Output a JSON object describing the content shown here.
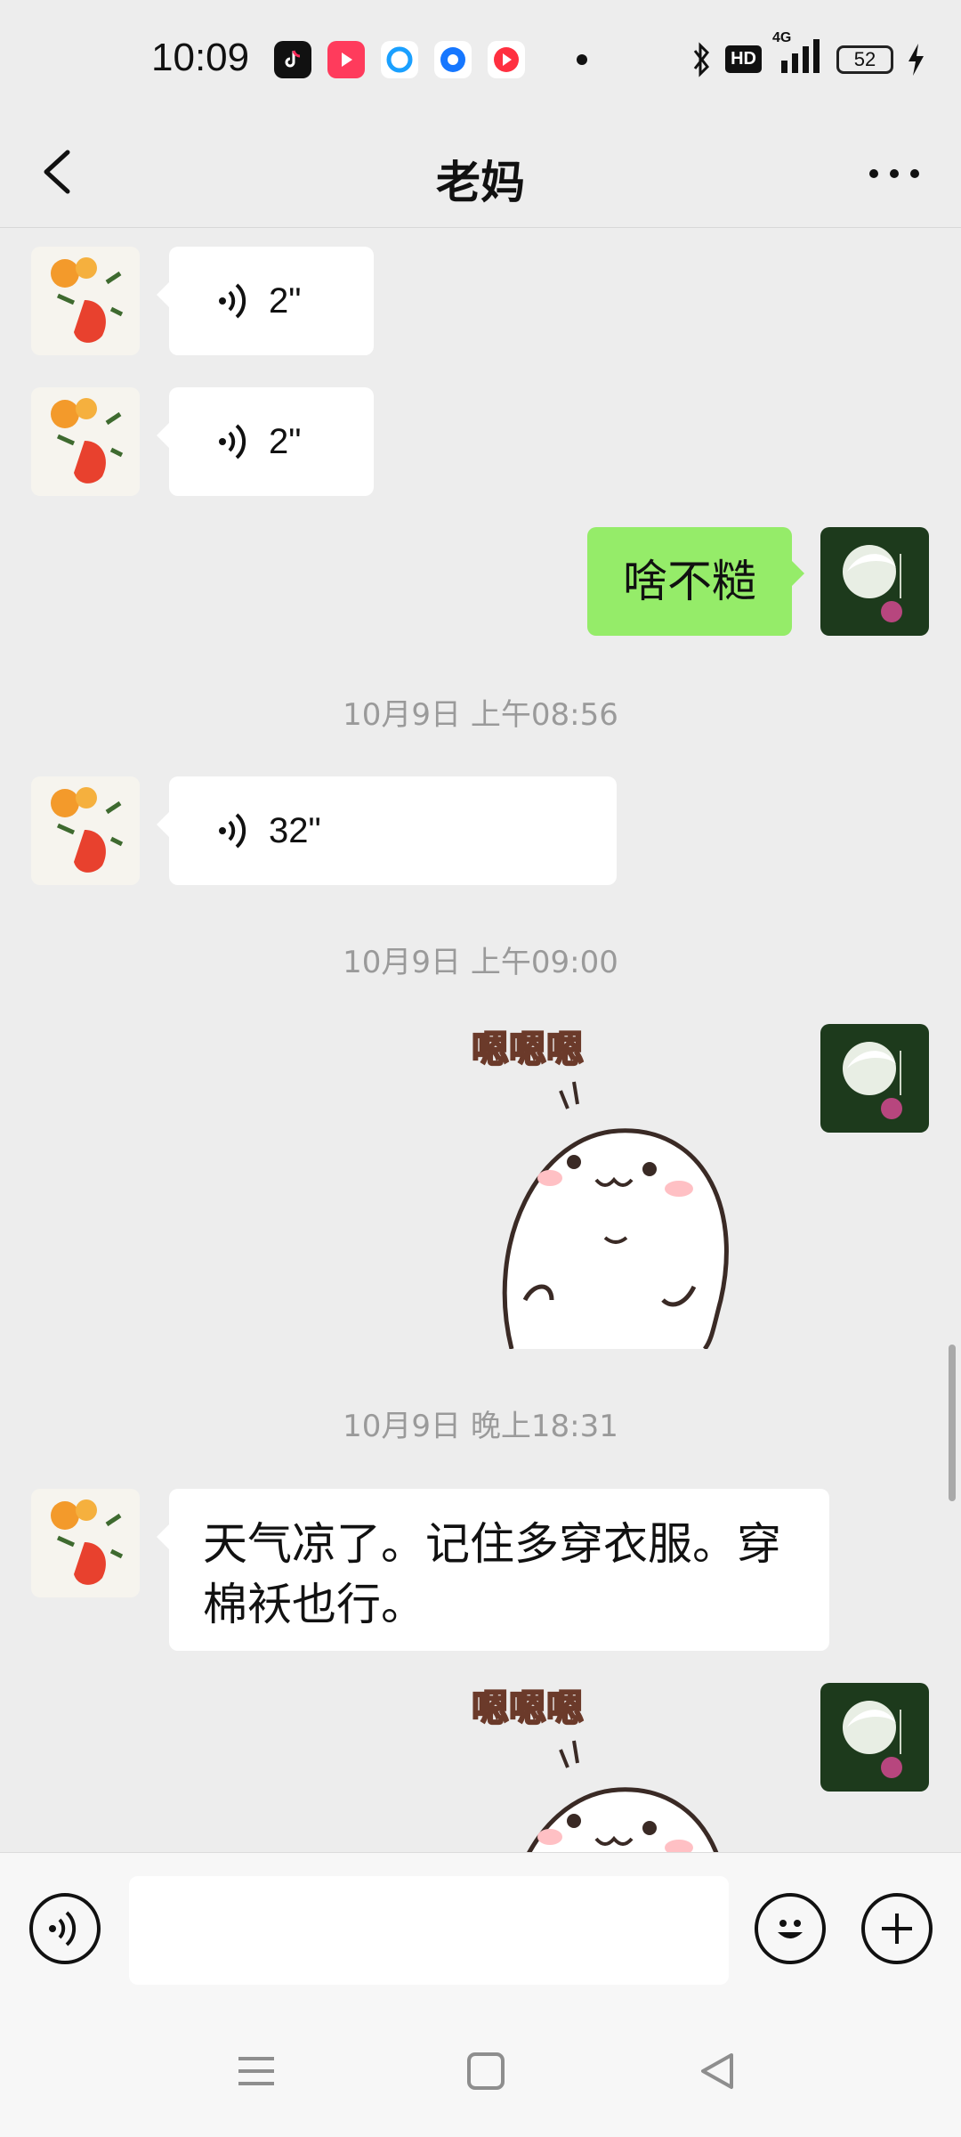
{
  "status": {
    "time": "10:09",
    "battery": "52",
    "network": "4G",
    "hd_label": "HD",
    "app_icons": [
      "tiktok-icon",
      "video-play-icon",
      "blue-circle-app-icon",
      "blue-dot-app-icon",
      "red-play-app-icon"
    ]
  },
  "header": {
    "title": "老妈"
  },
  "messages": [
    {
      "side": "left",
      "type": "voice",
      "duration": "2\""
    },
    {
      "side": "left",
      "type": "voice",
      "duration": "2\""
    },
    {
      "side": "right",
      "type": "text",
      "text": "啥不糙"
    },
    {
      "type": "time",
      "text": "10月9日 上午08:56"
    },
    {
      "side": "left",
      "type": "voice",
      "duration": "32\""
    },
    {
      "type": "time",
      "text": "10月9日 上午09:00"
    },
    {
      "side": "right",
      "type": "sticker",
      "text": "嗯嗯嗯"
    },
    {
      "type": "time",
      "text": "10月9日 晚上18:31"
    },
    {
      "side": "left",
      "type": "text",
      "text": "天气凉了。记住多穿衣服。穿棉袄也行。"
    },
    {
      "side": "right",
      "type": "sticker",
      "text": "嗯嗯嗯"
    }
  ],
  "input": {
    "placeholder": ""
  },
  "icons": {
    "back": "chevron-left-icon",
    "more": "more-dots-icon",
    "voice": "voice-icon",
    "emoji": "emoji-icon",
    "add": "plus-icon"
  }
}
